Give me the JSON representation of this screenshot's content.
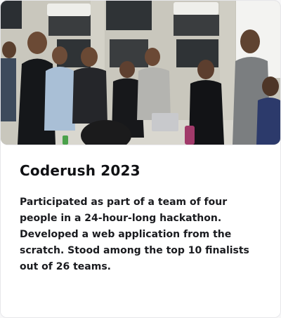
{
  "card": {
    "title": "Coderush 2023",
    "description": "Participated as part of a team of four people in a 24-hour-long hackathon. Developed a web application from the scratch. Stood among the top 10 finalists out of 26 teams."
  }
}
